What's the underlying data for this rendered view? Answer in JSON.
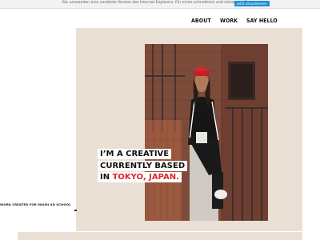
{
  "browser_notice": {
    "message": "Sie verwenden eine veraltete Version des Internet Explorers. Für einen schnelleren und sichereren Browser",
    "button_label": "Jetzt aktualisieren"
  },
  "nav": {
    "items": [
      "ABOUT",
      "WORK",
      "SAY HELLO"
    ]
  },
  "hero": {
    "line1": "I’M A CREATIVE",
    "line2": "CURRENTLY BASED",
    "line3_prefix": "IN",
    "line3_accent": "TOKYO, JAPAN."
  },
  "caption": "WORK CREATED FOR MIAMI AD SCHOOL",
  "colors": {
    "accent": "#e0262d",
    "panel": "#eadfd4",
    "update_button": "#1a8fd6"
  }
}
